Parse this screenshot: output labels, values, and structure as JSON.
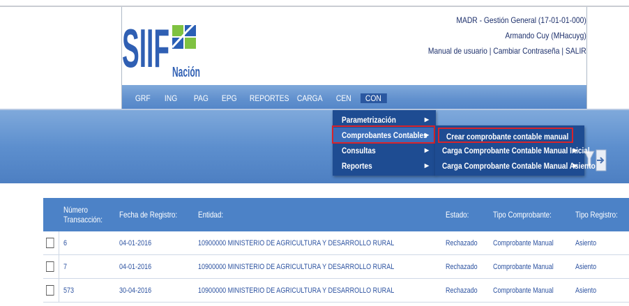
{
  "header": {
    "logo_text": "SIIF",
    "logo_subtext": "Nación",
    "entity_line": "MADR - Gestión General (17-01-01-000)",
    "user_line": "Armando Cuy (MHacuyg)",
    "links": [
      "Manual de usuario",
      "Cambiar Contraseña",
      "SALIR"
    ],
    "link_separator": "|"
  },
  "nav": {
    "items": [
      "GRF",
      "ING",
      "PAG",
      "EPG",
      "REPORTES",
      "CARGA",
      "CEN",
      "CON"
    ],
    "active": "CON"
  },
  "menu": {
    "items": [
      {
        "label": "Parametrización",
        "arrow": "▶"
      },
      {
        "label": "Comprobantes Contables",
        "arrow": "▶"
      },
      {
        "label": "Consultas",
        "arrow": "▶"
      },
      {
        "label": "Reportes",
        "arrow": "▶"
      }
    ],
    "highlighted_index": 1
  },
  "submenu": {
    "items": [
      {
        "label": "Crear comprobante contable manual"
      },
      {
        "label": "Carga Comprobante Contable Manual Inicial",
        "arrow": "▶"
      },
      {
        "label": "Carga Comprobante Contable Manual Asiento",
        "arrow": "▶"
      }
    ],
    "highlighted_index": 0
  },
  "table": {
    "headers": [
      "Número Transacción:",
      "Fecha de Registro:",
      "Entidad:",
      "Estado:",
      "Tipo Comprobante:",
      "Tipo Registro:"
    ],
    "header_line1": "Número",
    "header_line2": "Transacción:",
    "rows": [
      {
        "numero": "6",
        "fecha": "04-01-2016",
        "entidad": "10900000 MINISTERIO DE AGRICULTURA Y DESARROLLO RURAL",
        "estado": "Rechazado",
        "tipo_comprobante": "Comprobante Manual",
        "tipo_registro": "Asiento"
      },
      {
        "numero": "7",
        "fecha": "04-01-2016",
        "entidad": "10900000 MINISTERIO DE AGRICULTURA Y DESARROLLO RURAL",
        "estado": "Rechazado",
        "tipo_comprobante": "Comprobante Manual",
        "tipo_registro": "Asiento"
      },
      {
        "numero": "573",
        "fecha": "30-04-2016",
        "entidad": "10900000 MINISTERIO DE AGRICULTURA Y DESARROLLO RURAL",
        "estado": "Rechazado",
        "tipo_comprobante": "Comprobante Manual",
        "tipo_registro": "Asiento"
      }
    ]
  },
  "colors": {
    "nav_gradient_top": "#7fa8da",
    "menu_bg": "#1e4c92",
    "highlight_border": "#d8232a",
    "table_header": "#4c82c7",
    "link_text": "#2c52a0"
  },
  "icons": [
    "filter-icon",
    "exit-door-icon"
  ]
}
